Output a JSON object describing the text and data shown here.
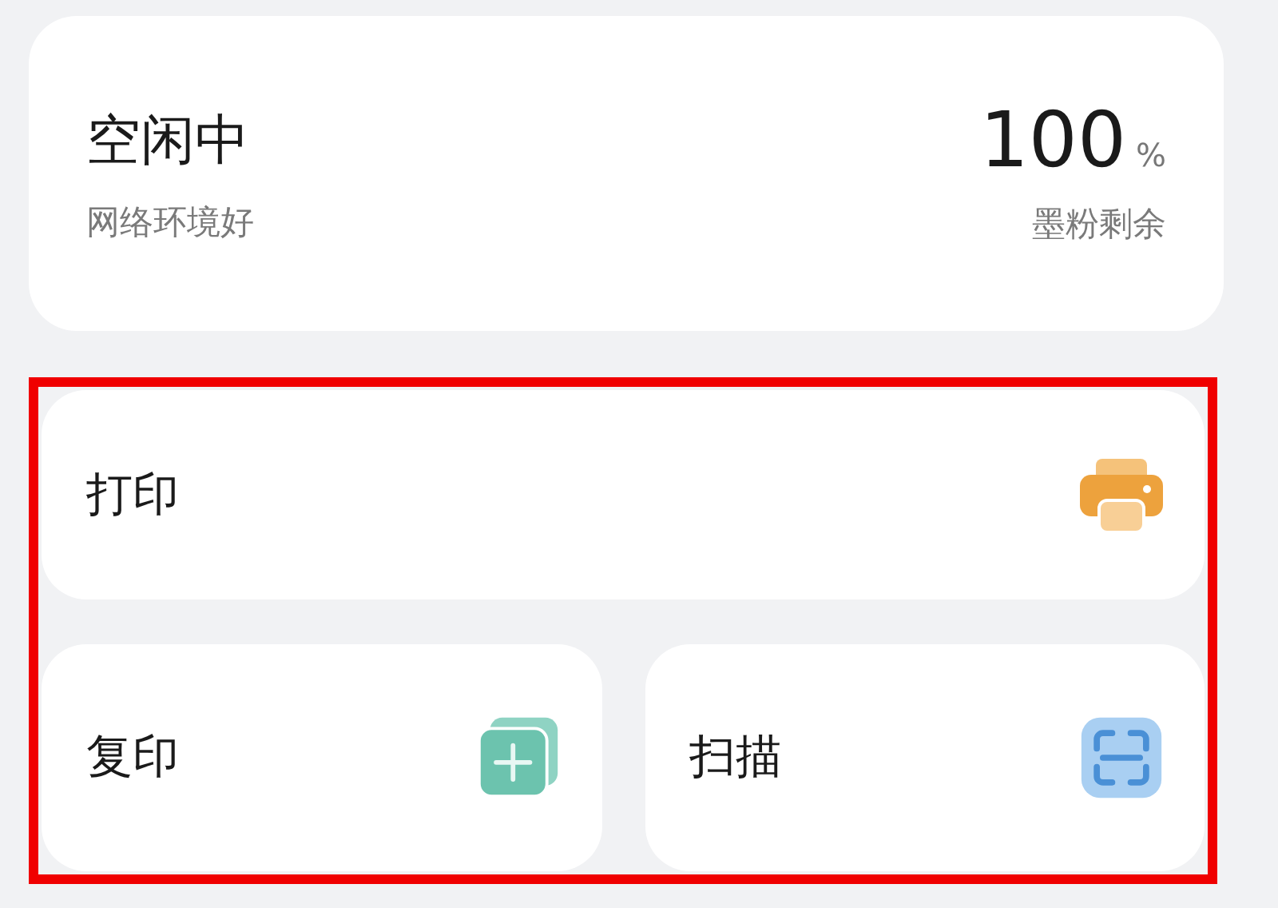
{
  "status": {
    "state": "空闲中",
    "network": "网络环境好",
    "toner_value": "100",
    "toner_unit": "%",
    "toner_label": "墨粉剩余"
  },
  "actions": [
    {
      "label": "打印",
      "kind": "print"
    },
    {
      "label": "复印",
      "kind": "copy"
    },
    {
      "label": "扫描",
      "kind": "scan"
    }
  ]
}
